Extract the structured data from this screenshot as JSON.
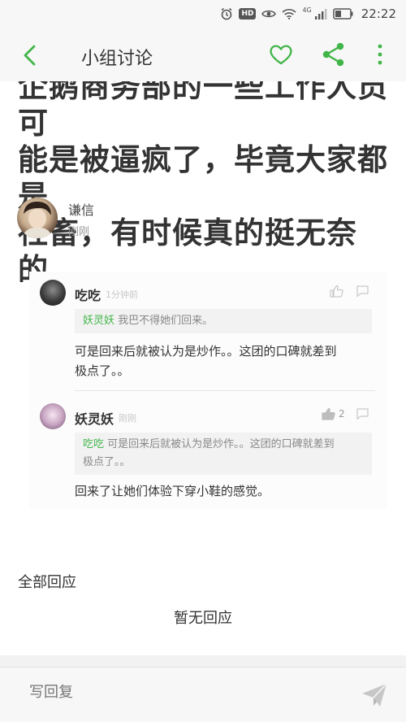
{
  "status_bar": {
    "network_label": "4G",
    "hd_label": "HD",
    "time": "22:22"
  },
  "appbar": {
    "title": "小组讨论",
    "accent_color": "#42b549"
  },
  "post": {
    "title_lines": [
      "企鹅商务部的一些工作人员可",
      "能是被逼疯了，毕竟大家都是",
      "社畜，有时候真的挺无奈的。"
    ],
    "author": {
      "name": "谦信",
      "time": "刚刚"
    }
  },
  "embedded_comments": [
    {
      "name": "吃吃",
      "time": "1分钟前",
      "quote_name": "妖灵妖",
      "quote_text": "我巴不得她们回来。",
      "body_lines": [
        "可是回来后就被认为是炒作。。这团的口碑就差到",
        "极点了。。"
      ],
      "like_count": ""
    },
    {
      "name": "妖灵妖",
      "time": "刚刚",
      "quote_name": "吃吃",
      "quote_text_lines": [
        "可是回来后就被认为是炒作。。这团的口碑就差到",
        "极点了。。"
      ],
      "body_lines": [
        "回来了让她们体验下穿小鞋的感觉。"
      ],
      "like_count": "2"
    }
  ],
  "replies": {
    "section_label": "全部回应",
    "empty_text": "暂无回应"
  },
  "reply_bar": {
    "placeholder": "写回复"
  }
}
